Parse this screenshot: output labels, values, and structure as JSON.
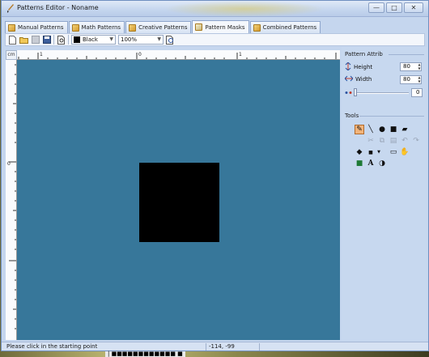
{
  "window": {
    "title": "Patterns Editor - Noname",
    "minimize": "—",
    "maximize": "□",
    "close": "✕"
  },
  "tabs": [
    {
      "label": "Manual Patterns"
    },
    {
      "label": "Math Patterns"
    },
    {
      "label": "Creative Patterns"
    },
    {
      "label": "Pattern Masks"
    },
    {
      "label": "Combined Patterns"
    }
  ],
  "active_tab": "Pattern Masks",
  "toolbar": {
    "color_value": "Black",
    "zoom_value": "100%"
  },
  "ruler": {
    "unit": "cm",
    "h_labels": [
      "1",
      "0",
      "1"
    ],
    "v_label": "0"
  },
  "canvas": {
    "background": "#37779a",
    "mask_color": "#000000"
  },
  "pattern_attrib": {
    "title": "Pattern Attrib",
    "height_label": "Height",
    "height_value": "80",
    "width_label": "Width",
    "width_value": "80",
    "slider_value": "0"
  },
  "tools": {
    "title": "Tools"
  },
  "status": {
    "message": "Please click in the starting point",
    "coords": "-114, -99"
  },
  "footer_fragment": "| ■■■■■■■■■■■■ ■"
}
